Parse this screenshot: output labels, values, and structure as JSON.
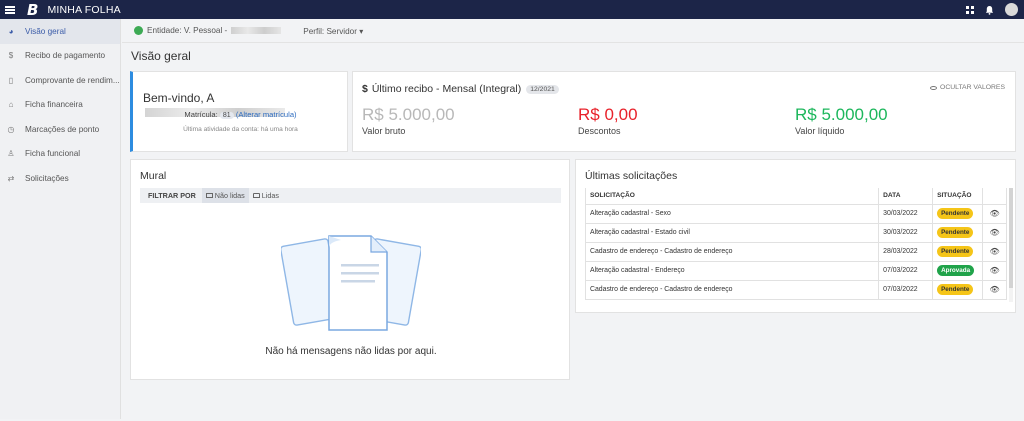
{
  "topbar": {
    "app_title": "MINHA FOLHA",
    "logo_text": "B"
  },
  "sidebar": {
    "items": [
      {
        "label": "Visão geral",
        "icon": "pie-chart-icon",
        "glyph": "◕"
      },
      {
        "label": "Recibo de pagamento",
        "icon": "dollar-icon",
        "glyph": "$"
      },
      {
        "label": "Comprovante de rendim...",
        "icon": "document-icon",
        "glyph": "▯"
      },
      {
        "label": "Ficha financeira",
        "icon": "bank-icon",
        "glyph": "⌂"
      },
      {
        "label": "Marcações de ponto",
        "icon": "clock-icon",
        "glyph": "◷"
      },
      {
        "label": "Ficha funcional",
        "icon": "user-icon",
        "glyph": "♙"
      },
      {
        "label": "Solicitações",
        "icon": "exchange-icon",
        "glyph": "⇄"
      }
    ]
  },
  "entity_bar": {
    "entity_label": "Entidade: V. Pessoal -",
    "profile_label": "Perfil: Servidor ▾"
  },
  "page": {
    "title": "Visão geral"
  },
  "welcome": {
    "greeting": "Bem-vindo, A",
    "matricula_label": "Matrícula:",
    "matricula_number": "81",
    "alter_link": "(Alterar matrícula)",
    "last_activity": "Última atividade da conta: há uma hora"
  },
  "receipt": {
    "dollar": "$",
    "title": "Último recibo - Mensal (Integral)",
    "date_badge": "12/2021",
    "hide_values": "OCULTAR VALORES",
    "gross_value": "R$ 5.000,00",
    "gross_label": "Valor bruto",
    "discounts_value": "R$ 0,00",
    "discounts_label": "Descontos",
    "net_value": "R$ 5.000,00",
    "net_label": "Valor líquido"
  },
  "colors": {
    "gross": "#b8b8b8",
    "discounts": "#e8222b",
    "net": "#1db75c",
    "accent": "#2d8ce0",
    "topbar": "#1c2548"
  },
  "mural": {
    "title": "Mural",
    "filter_label": "FILTRAR POR",
    "filter_unread": "Não lidas",
    "filter_read": "Lidas",
    "empty_message": "Não há mensagens não lidas por aqui."
  },
  "requests": {
    "title": "Últimas solicitações",
    "columns": [
      "SOLICITAÇÃO",
      "DATA",
      "SITUAÇÃO"
    ],
    "rows": [
      {
        "request": "Alteração cadastral - Sexo",
        "date": "30/03/2022",
        "status": "Pendente"
      },
      {
        "request": "Alteração cadastral - Estado civil",
        "date": "30/03/2022",
        "status": "Pendente"
      },
      {
        "request": "Cadastro de endereço - Cadastro de endereço",
        "date": "28/03/2022",
        "status": "Pendente"
      },
      {
        "request": "Alteração cadastral - Endereço",
        "date": "07/03/2022",
        "status": "Aprovada"
      },
      {
        "request": "Cadastro de endereço - Cadastro de endereço",
        "date": "07/03/2022",
        "status": "Pendente"
      }
    ]
  }
}
